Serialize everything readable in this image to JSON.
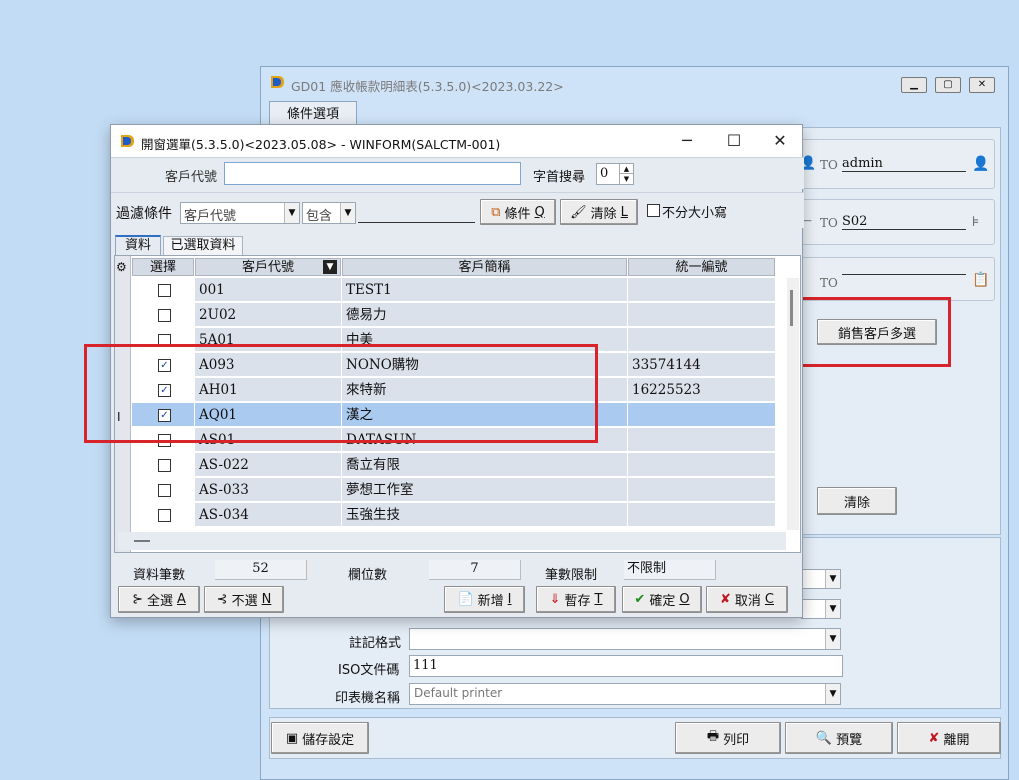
{
  "background_window": {
    "title": "GD01 應收帳款明細表(5.3.5.0)<2023.03.22>",
    "tab": "條件選項",
    "to_label": "TO",
    "to_value_1": "admin",
    "to_value_2": "S02",
    "to_value_3": "",
    "multi_select_button": "銷售客戶多選",
    "clear_button": "清除",
    "note_format_label": "註記格式",
    "iso_label": "ISO文件碼",
    "iso_value": "111",
    "printer_label": "印表機名稱",
    "printer_value": "Default printer",
    "save_settings": "儲存設定",
    "print": "列印",
    "preview": "預覽",
    "exit": "離開"
  },
  "dialog": {
    "title": "開窗選單(5.3.5.0)<2023.05.08> - WINFORM(SALCTM-001)",
    "customer_code_label": "客戶代號",
    "customer_code_value": "",
    "first_char_search_label": "字首搜尋",
    "first_char_search_value": "0",
    "filter_label": "過濾條件",
    "filter_field": "客戶代號",
    "filter_op": "包含",
    "filter_value": "",
    "condition_button": {
      "text": "條件",
      "key": "Q"
    },
    "clear_button": {
      "text": "清除",
      "key": "L"
    },
    "case_insensitive_label": "不分大小寫",
    "tabs": [
      "資料",
      "已選取資料"
    ],
    "columns": [
      "選擇",
      "客戶代號",
      "客戶簡稱",
      "統一編號"
    ],
    "rows": [
      {
        "checked": false,
        "code": "001",
        "name": "TEST1",
        "tax_id": ""
      },
      {
        "checked": false,
        "code": "2U02",
        "name": "德易力",
        "tax_id": ""
      },
      {
        "checked": false,
        "code": "5A01",
        "name": "中美",
        "tax_id": ""
      },
      {
        "checked": true,
        "code": "A093",
        "name": "NONO購物",
        "tax_id": "33574144"
      },
      {
        "checked": true,
        "code": "AH01",
        "name": "來特新",
        "tax_id": "16225523"
      },
      {
        "checked": true,
        "code": "AQ01",
        "name": "漢之",
        "tax_id": ""
      },
      {
        "checked": false,
        "code": "AS01",
        "name": "DATASUN",
        "tax_id": ""
      },
      {
        "checked": false,
        "code": "AS-022",
        "name": "喬立有限",
        "tax_id": ""
      },
      {
        "checked": false,
        "code": "AS-033",
        "name": "夢想工作室",
        "tax_id": ""
      },
      {
        "checked": false,
        "code": "AS-034",
        "name": "玉強生技",
        "tax_id": ""
      }
    ],
    "record_count_label": "資料筆數",
    "record_count": "52",
    "field_count_label": "欄位數",
    "field_count": "7",
    "limit_label": "筆數限制",
    "limit_value": "不限制",
    "select_all": {
      "text": "全選",
      "key": "A"
    },
    "deselect": {
      "text": "不選",
      "key": "N"
    },
    "add": {
      "text": "新增",
      "key": "I"
    },
    "temp_save": {
      "text": "暫存",
      "key": "T"
    },
    "confirm": {
      "text": "確定",
      "key": "O"
    },
    "cancel": {
      "text": "取消",
      "key": "C"
    }
  },
  "colors": {
    "selected_row": "#aacaf0",
    "alt_row": "#dbe1ea",
    "highlight_red": "#d8232a",
    "desktop": "#c3dcf5"
  }
}
